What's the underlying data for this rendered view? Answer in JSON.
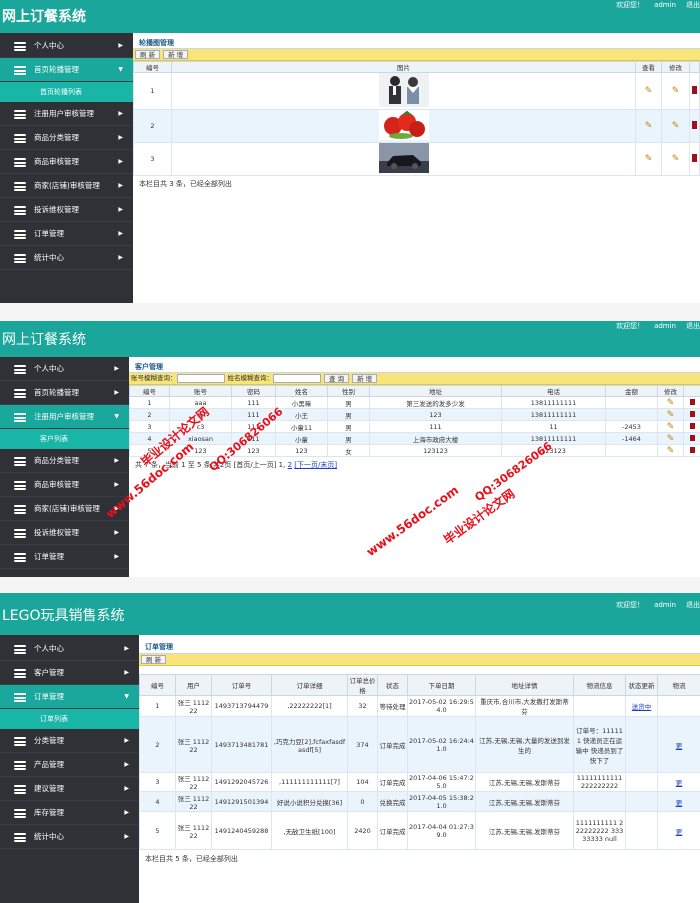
{
  "colors": {
    "header": "#1aa69a",
    "sidebar": "#2f3137",
    "active": "#19a89b",
    "toolbar": "#f7e57a",
    "watermark": "#e8101a"
  },
  "s1": {
    "title": "网上订餐系统",
    "user": [
      "欢迎您！",
      "admin",
      "退出"
    ],
    "menu": [
      {
        "label": "个人中心",
        "icon": "menu-stack-icon"
      },
      {
        "label": "首页轮播管理",
        "icon": "menu-stack-icon",
        "active": true,
        "sub": "首页轮播列表"
      },
      {
        "label": "注册用户审核管理",
        "icon": "menu-stack-icon"
      },
      {
        "label": "商品分类管理",
        "icon": "menu-stack-icon"
      },
      {
        "label": "商品审核管理",
        "icon": "menu-stack-icon"
      },
      {
        "label": "商家(店铺)审核管理",
        "icon": "menu-stack-icon"
      },
      {
        "label": "投诉维权管理",
        "icon": "menu-stack-icon"
      },
      {
        "label": "订单管理",
        "icon": "menu-stack-icon"
      },
      {
        "label": "统计中心",
        "icon": "menu-stack-icon"
      }
    ],
    "crumb": "轮播图管理",
    "buttons": [
      "刷 新",
      "新 增"
    ],
    "headers": [
      "编号",
      "图片",
      "查看",
      "修改",
      ""
    ],
    "rows": [
      {
        "id": "1",
        "img": "business-people-image"
      },
      {
        "id": "2",
        "img": "tomatoes-image"
      },
      {
        "id": "3",
        "img": "car-image"
      }
    ],
    "footer": "本栏目共 3 条，已经全部列出"
  },
  "s2": {
    "title": "网上订餐系统",
    "user": [
      "欢迎您！",
      "admin",
      "退出"
    ],
    "menu": [
      {
        "label": "个人中心"
      },
      {
        "label": "首页轮播管理"
      },
      {
        "label": "注册用户审核管理",
        "active": true,
        "sub": "客户列表"
      },
      {
        "label": "商品分类管理"
      },
      {
        "label": "商品审核管理"
      },
      {
        "label": "商家(店铺)审核管理"
      },
      {
        "label": "投诉维权管理"
      },
      {
        "label": "订单管理"
      }
    ],
    "crumb": "客户管理",
    "search_label_1": "账号模糊查询：",
    "search_label_2": "姓名模糊查询：",
    "buttons": [
      "查 询",
      "新 增"
    ],
    "headers": [
      "编号",
      "账号",
      "密码",
      "姓名",
      "性别",
      "地址",
      "电话",
      "金额",
      "修改",
      ""
    ],
    "rows": [
      [
        "1",
        "aaa",
        "111",
        "小黑嘛",
        "男",
        "第三发送的发多少发",
        "13811111111",
        ""
      ],
      [
        "2",
        "a",
        "111",
        "小王",
        "男",
        "123",
        "13811111111",
        ""
      ],
      [
        "3",
        "c3",
        "111",
        "小童11",
        "男",
        "111",
        "11",
        "-2453"
      ],
      [
        "4",
        "xiaosan",
        "111",
        "小童",
        "男",
        "上海市政府大楼",
        "13811111111",
        "-1464"
      ],
      [
        "5",
        "123",
        "123",
        "123",
        "女",
        "123123",
        "123123",
        ""
      ]
    ],
    "footer_text": "共 7 条，当前 1 至 5 条 共2页 [首页/上一页] 1,",
    "footer_page2": "2",
    "footer_next": "[下一页/末页]",
    "watermark_site": "www.56doc.com",
    "watermark_qq": "QQ:306826066",
    "watermark_name": "毕业设计论文网"
  },
  "s3": {
    "title": "LEGO玩具销售系统",
    "user": [
      "欢迎您！",
      "admin",
      "退出"
    ],
    "menu": [
      {
        "label": "个人中心"
      },
      {
        "label": "客户管理"
      },
      {
        "label": "订单管理",
        "active": true,
        "sub": "订单列表"
      },
      {
        "label": "分类管理"
      },
      {
        "label": "产品管理"
      },
      {
        "label": "建议管理"
      },
      {
        "label": "库存管理"
      },
      {
        "label": "统计中心"
      }
    ],
    "crumb": "订单管理",
    "buttons": [
      "刷 新"
    ],
    "headers": [
      "编号",
      "用户",
      "订单号",
      "订单详细",
      "订单总价格",
      "状态",
      "下单日期",
      "地址详情",
      "物流信息",
      "状态更新",
      "物流"
    ],
    "rows": [
      [
        "1",
        "张三 111222",
        "1493713794479",
        ",22222222[1]",
        "32",
        "等待处理",
        "2017-05-02 16:29:54.0",
        "重庆市,合川市,大发撒打发斯蒂芬",
        "",
        "送货中",
        ""
      ],
      [
        "2",
        "张三 111222",
        "1493713481781",
        ",巧克力豆[2],fcfaxfasdfasdf[5]",
        "374",
        "订单完成",
        "2017-05-02 16:24:41.0",
        "江苏,无锡,无锡,大量的发送到发生的",
        "订单号：111111 快递员正在运输中 快递员到了快下了",
        "",
        "更"
      ],
      [
        "3",
        "张三 111222",
        "1491292045726",
        ",111111111111[7]",
        "104",
        "订单完成",
        "2017-04-06 15:47:25.0",
        "江苏,无锡,无锡,发斯蒂芬",
        "11111111111 222222222",
        "",
        "更"
      ],
      [
        "4",
        "张三 111222",
        "1491291501394",
        "好说小说积分兑换[36]",
        "0",
        "兑换完成",
        "2017-04-05 15:38:21.0",
        "江苏,无锡,无锡,发斯蒂芬",
        "",
        "",
        "更"
      ],
      [
        "5",
        "张三 111222",
        "1491240459288",
        ",无敌卫生纸[100]",
        "2420",
        "订单完成",
        "2017-04-04 01:27:39.0",
        "江苏,无锡,无锡,发斯蒂芬",
        "1111111111 222222222 33333333 null",
        "",
        "更"
      ]
    ],
    "footer": "本栏目共 5 条，已经全部列出"
  }
}
